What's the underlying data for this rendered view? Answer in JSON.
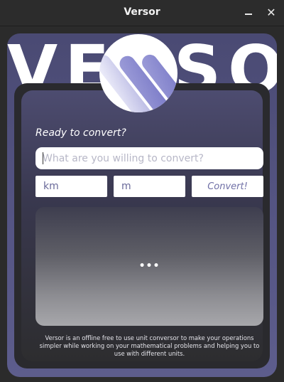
{
  "window": {
    "title": "Versor",
    "minimize_icon": "minimize-icon",
    "close_icon": "close-icon",
    "close_glyph": "✕"
  },
  "header": {
    "background_word": "VERSOR",
    "logo_icon": "versor-logo-icon"
  },
  "main": {
    "prompt": "Ready to convert?",
    "search": {
      "value": "",
      "placeholder": "What are you willing to convert?"
    },
    "from_unit": {
      "value": "km"
    },
    "to_unit": {
      "value": "m"
    },
    "convert_label": "Convert!",
    "output_placeholder": "•••",
    "description": "Versor is an offline free to use unit conversor to make your operations simpler while working on your mathematical problems and helping you to use with different units."
  },
  "colors": {
    "accent": "#6f6fa6",
    "card_bg": "#4a4a73",
    "frame_bg": "#2a2a2e",
    "titlebar_bg": "#2c2c2c"
  }
}
